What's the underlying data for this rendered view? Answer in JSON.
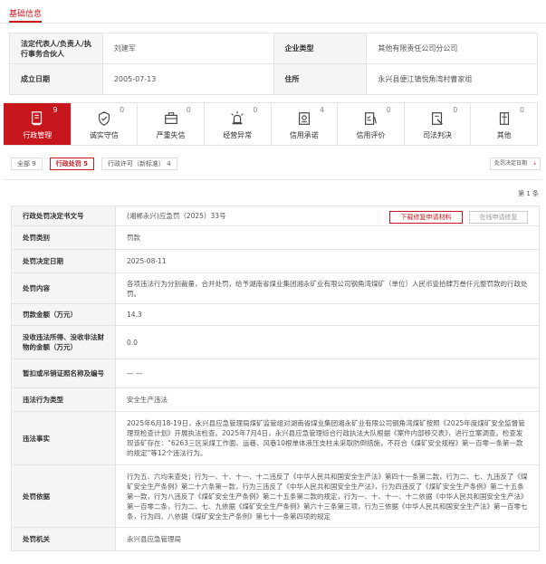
{
  "section": {
    "title": "基础信息"
  },
  "basic": {
    "rows": [
      {
        "l1": "法定代表人/负责人/执行事务合伙人",
        "v1": "刘建军",
        "l2": "企业类型",
        "v2": "其他有限责任公司分公司"
      },
      {
        "l1": "成立日期",
        "v1": "2005-07-13",
        "l2": "住所",
        "v2": "永兴县便江镇悦角湾村曹家组"
      }
    ]
  },
  "tabs": [
    {
      "label": "行政管理",
      "count": "9",
      "icon": "document-stamp-icon"
    },
    {
      "label": "诚实守信",
      "count": "0",
      "icon": "shield-hand-icon"
    },
    {
      "label": "严重失信",
      "count": "0",
      "icon": "briefcase-icon"
    },
    {
      "label": "经营异常",
      "count": "0",
      "icon": "alarm-light-icon"
    },
    {
      "label": "信用承诺",
      "count": "4",
      "icon": "certificate-icon"
    },
    {
      "label": "信用评价",
      "count": "0",
      "icon": "checklist-pen-icon"
    },
    {
      "label": "司法判决",
      "count": "0",
      "icon": "gavel-doc-icon"
    },
    {
      "label": "其他",
      "count": "0",
      "icon": "folder-icon"
    }
  ],
  "filters": [
    {
      "label": "全部",
      "count": "9"
    },
    {
      "label": "行政处罚",
      "count": "5"
    },
    {
      "label": "行政许可（新标准）",
      "count": "4"
    }
  ],
  "sort": {
    "label": "处罚决定日期"
  },
  "pager": {
    "text": "第 1 条"
  },
  "buttons": {
    "download": "下载修复申请材料",
    "online": "在线申请修复"
  },
  "detail": [
    {
      "label": "行政处罚决定书文号",
      "value": "(湘郴永兴)应急罚（2025）33号"
    },
    {
      "label": "处罚类别",
      "value": "罚款"
    },
    {
      "label": "处罚决定日期",
      "value": "2025-08-11"
    },
    {
      "label": "处罚内容",
      "value": "各项违法行为分别裁量，合并处罚，给予湖南省煤业集团湘永矿业有限公司钢角湾煤矿（单位）人民币壹拾肆万叁仟元整罚款的行政处罚。"
    },
    {
      "label": "罚款金额（万元）",
      "value": "14.3"
    },
    {
      "label": "没收违法所得、没收非法财物的金额（万元）",
      "value": "0.0"
    },
    {
      "label": "暂扣或吊销证照名称及编号",
      "value": "— —"
    },
    {
      "label": "违法行为类型",
      "value": "安全生产违法"
    },
    {
      "label": "违法事实",
      "value": "2025年6月18-19日，永兴县应急管理局煤矿监管组对湖南省煤业集团湘永矿业有限公司钢角湾煤矿按照《2025年度煤矿安全监督管理现检查计划》开展执法检查。2025年7月4日，永兴县应急管理综合行政执法大队根据《案件内部移交表》，进行立案调查。检查发现该矿存在：“6263三区采煤工作面、运巷、风巷10根单体液压支柱未采取防倒措施，不符合《煤矿安全规程》第一百零一条第一款的规定”等12个违法行为。"
    },
    {
      "label": "处罚依据",
      "value": "行为五、六均来查处；行为一、十、十一、十二违反了《中华人民共和国安全生产法》第四十一条第二款，行为二、七、九违反了《煤矿安全生产条例》第二十六条第一款，行为三违反了《中华人民共和国安全生产法》，行为四违反了《煤矿安全生产条例》第二十五条第一款，行为八违反了《煤矿安全生产条例》第二十五条第二款的规定，行为一、十、十一、十二依据《中华人民共和国安全生产法》第一百零二条，行为二、七、九依据《煤矿安全生产条例》第六十三条第三项，行为三依据《中华人民共和国安全生产法》第一百零七条，行为四、八依据《煤矿安全生产条例》第七十一条第四项的规定"
    },
    {
      "label": "处罚机关",
      "value": "永兴县应急管理局"
    }
  ]
}
